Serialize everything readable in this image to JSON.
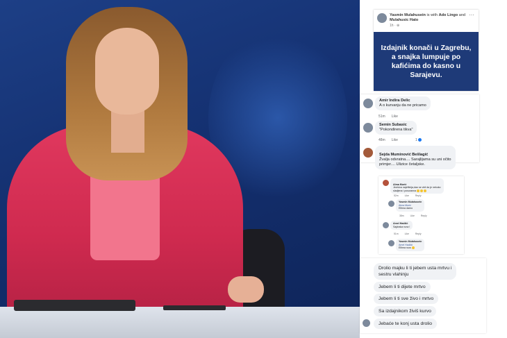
{
  "photo": {
    "description_icon": "news-anchor-photo"
  },
  "post": {
    "author": "Yasmin Mulahusein",
    "with_text": " is with ",
    "tagged_1": "Ado Lingo",
    "and_text": " and ",
    "tagged_2": "Mulahusic Hato",
    "time": "1h · ⊕",
    "more": "···",
    "banner_text": "Izdajnik konači u Zagrebu,\na snajka lumpuje po\nkafićima do kasno u\nSarajevu."
  },
  "comments": [
    {
      "author": "Amir Indira Delic",
      "text": "A o kurvanju da ne pricamo",
      "time": "51m",
      "like": "Like"
    },
    {
      "author": "Semin Subasic",
      "text": "\"Pokondirena tikva\"",
      "time": "48m",
      "like": "Like",
      "reactions": "1"
    },
    {
      "author": "Sejda Muminović Bešlagić",
      "text": "Žvalja odvratna.... Sarajlijama su uni očito\nprimjer.... Ulizice četaljske."
    }
  ],
  "thread": [
    {
      "author": "Alma Murić",
      "text": "Jezivica najeftinija,dao se vidi da je nekoko\nsladjena i posuranna",
      "time": "52m",
      "like": "Like",
      "reply": "Reply"
    },
    {
      "author": "Yasmin Mulahusein",
      "mention": "Alma Murić",
      "text": "Eltima darno",
      "time": "38m",
      "like": "Like",
      "reply": "Reply"
    },
    {
      "author": "Amel Hadžić",
      "text": "Sajdraka runa !",
      "time": "51m",
      "like": "Like",
      "reply": "Reply"
    },
    {
      "author": "Yasmin Mulahusein",
      "mention": "Amel Hadžić",
      "text": "Eltima ruos"
    }
  ],
  "insults": [
    {
      "text": "Drolio majku li ti jebem usta mrtvu i\nsestru vlahinju"
    },
    {
      "text": "Jebem li ti dijete mrtvo"
    },
    {
      "text": "Jebem li ti sve živo i mrtvo"
    },
    {
      "text": "Sa izdajnikom živiš kurvo"
    },
    {
      "text": "Jebaće te konj usta drolio"
    }
  ]
}
